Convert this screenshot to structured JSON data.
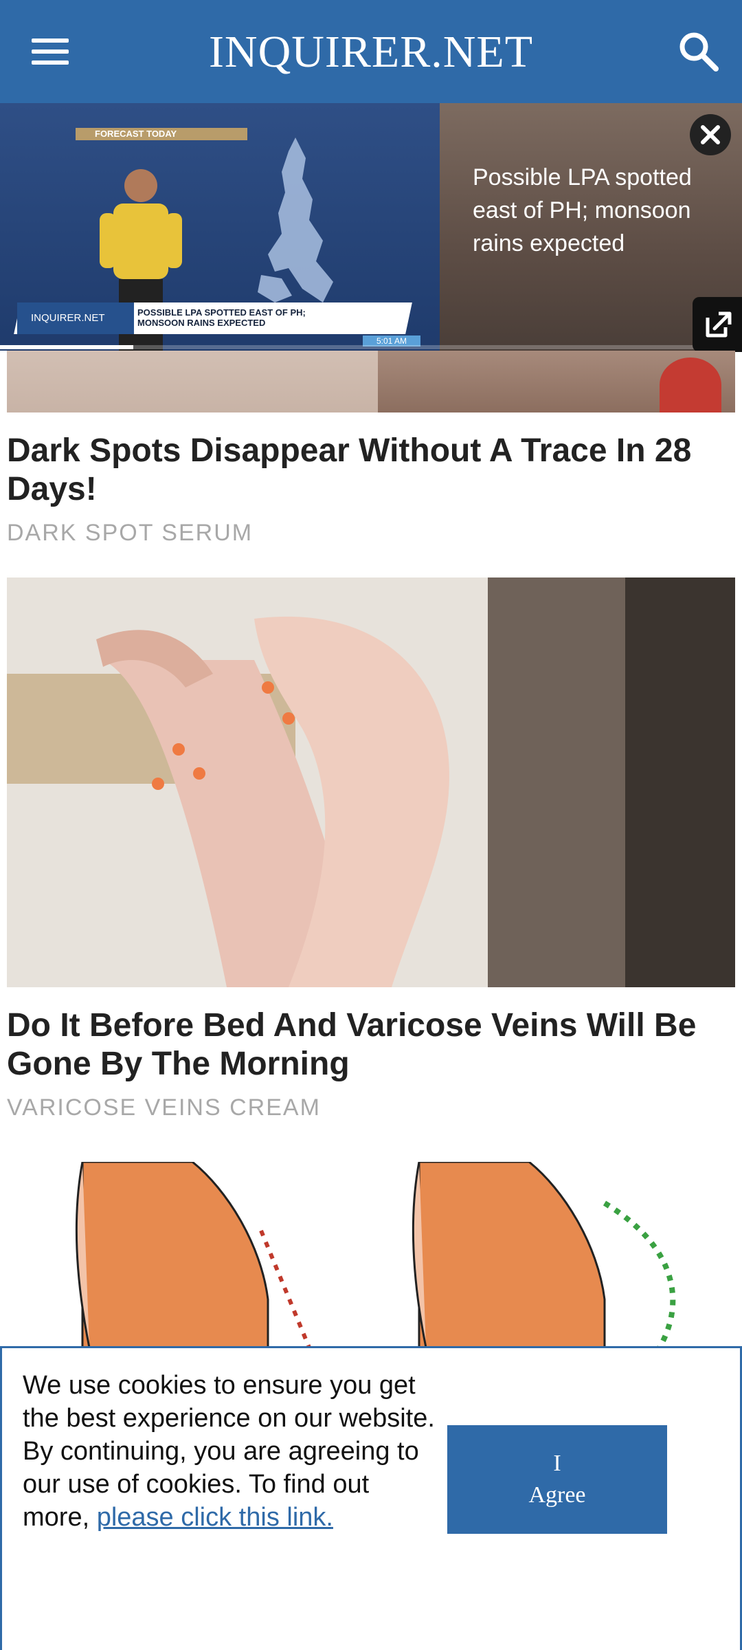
{
  "header": {
    "logo": "INQUIRER.NET",
    "menu_icon": "hamburger-menu-icon",
    "search_icon": "search-icon",
    "background_color": "#2f6aa8"
  },
  "video_player": {
    "title": "Possible LPA spotted east of PH; monsoon rains expected",
    "overlay_label": "FORECAST TODAY",
    "lower_third_brand": "INQUIRER.NET",
    "lower_third_line1": "POSSIBLE LPA SPOTTED EAST OF PH;",
    "lower_third_line2": "MONSOON RAINS EXPECTED",
    "time": "5:01 AM",
    "progress": 0.18,
    "close_icon": "close-icon",
    "external_icon": "external-link-icon"
  },
  "ads": [
    {
      "title": "Dark Spots Disappear Without A Trace In 28 Days!",
      "source": "DARK SPOT SERUM"
    },
    {
      "title": "Do It Before Bed And Varicose Veins Will Be Gone By The Morning",
      "source": "VARICOSE VEINS CREAM"
    }
  ],
  "cookie_banner": {
    "text": "We use cookies to ensure you get the best experience on our website. By continuing, you are agreeing to our use of cookies. To find out more, ",
    "link_text": "please click this link.",
    "button_label": "I Agree"
  }
}
